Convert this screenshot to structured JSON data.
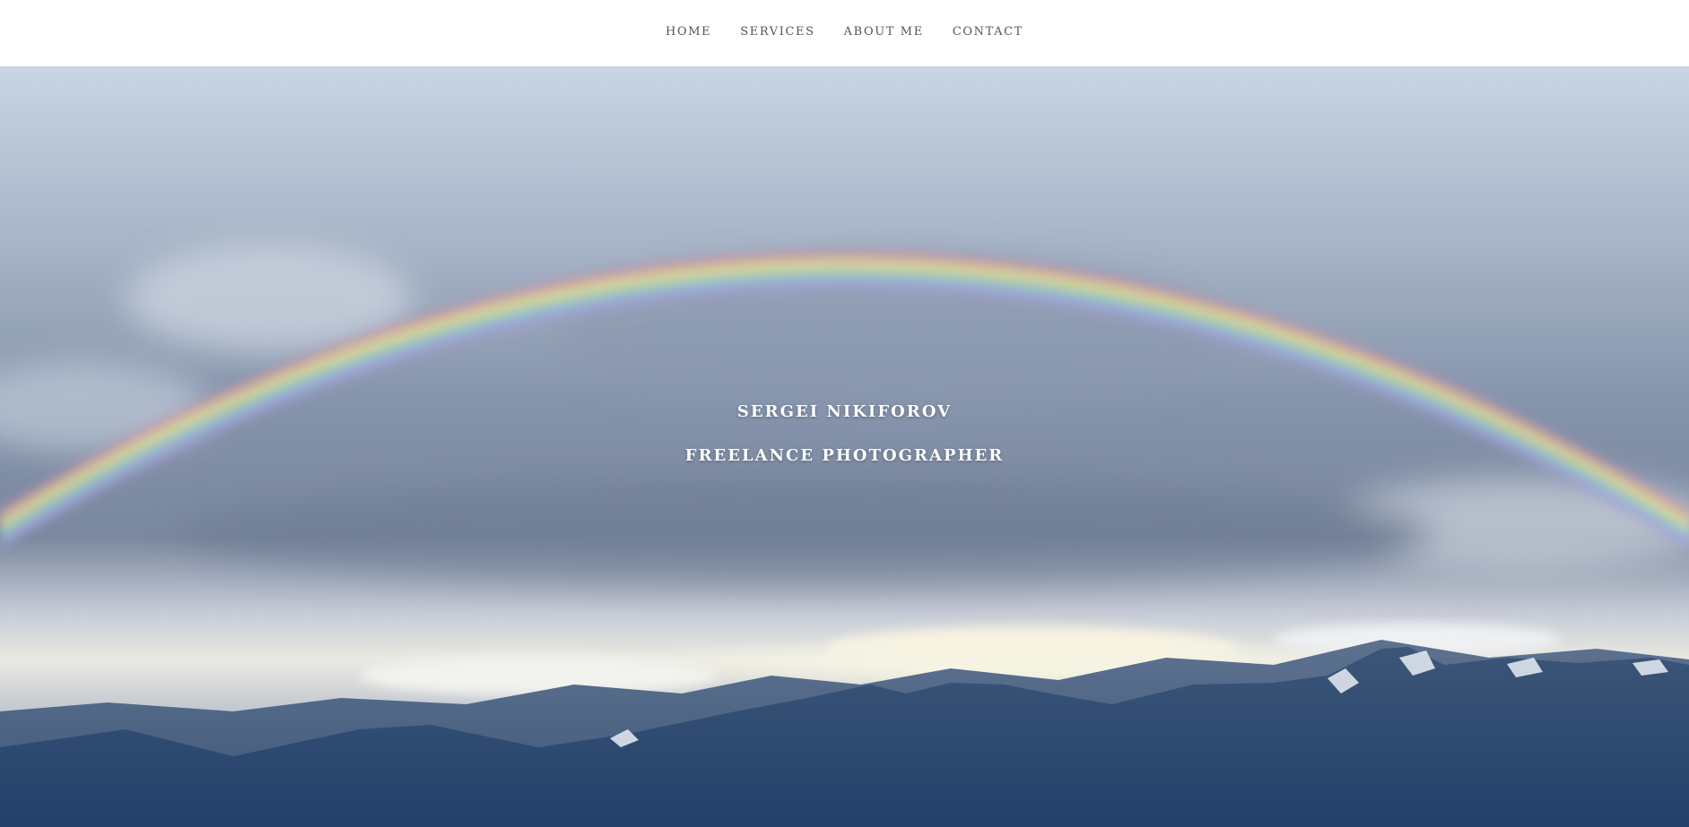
{
  "nav": {
    "items": [
      {
        "label": "HOME"
      },
      {
        "label": "SERVICES"
      },
      {
        "label": "ABOUT ME"
      },
      {
        "label": "CONTACT"
      }
    ]
  },
  "hero": {
    "name": "SERGEI NIKIFOROV",
    "tagline": "FREELANCE PHOTOGRAPHER",
    "image_subject": "rainbow-over-mountains-photo"
  },
  "colors": {
    "nav_text": "#555555",
    "hero_text": "#ffffff",
    "sky_top": "#c9d6e6",
    "sky_mid": "#7f8ea6",
    "mountains": "#2b4568"
  }
}
